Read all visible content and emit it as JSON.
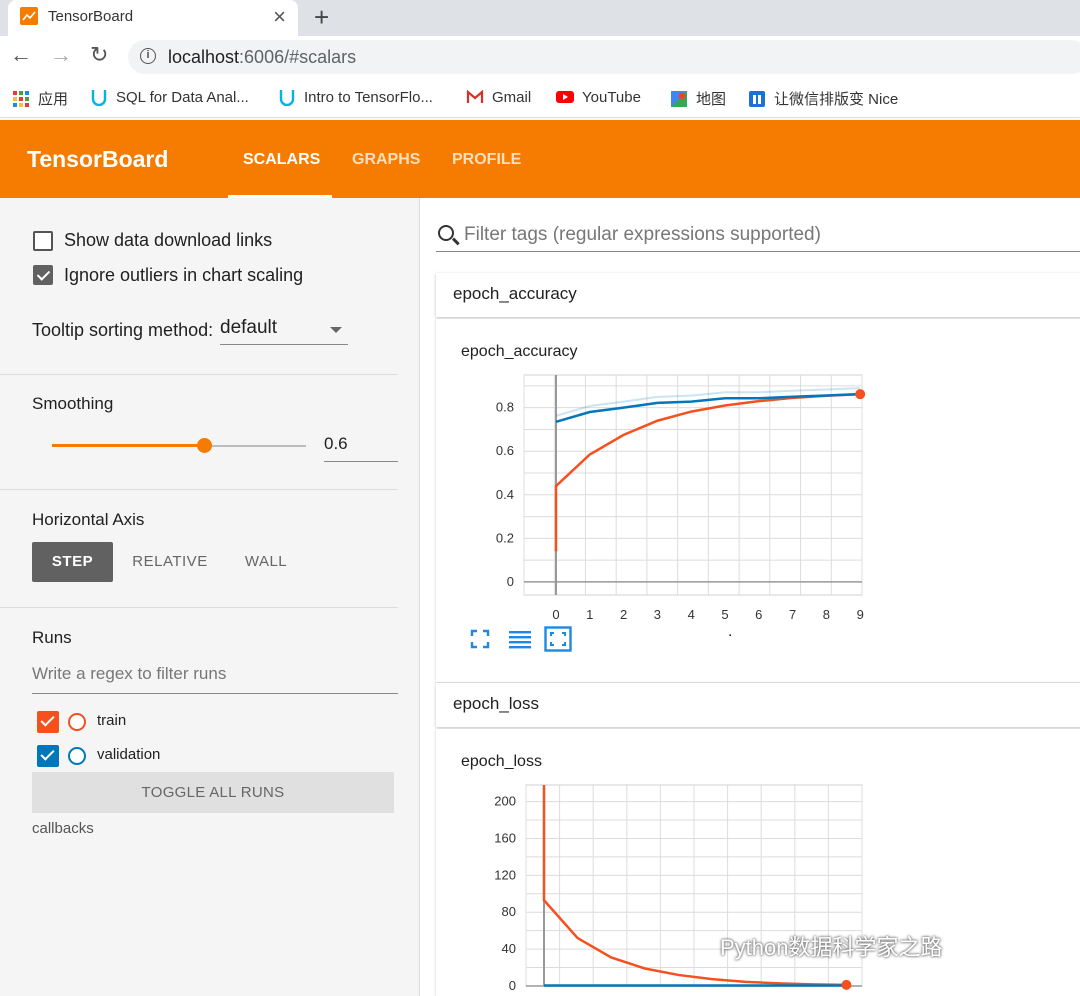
{
  "browser": {
    "tab_title": "TensorBoard",
    "url_host": "localhost",
    "url_rest": ":6006/#scalars",
    "bookmarks": [
      {
        "label": "应用",
        "icon": "apps-grid-icon"
      },
      {
        "label": "SQL for Data Anal...",
        "icon": "udacity-icon"
      },
      {
        "label": "Intro to TensorFlo...",
        "icon": "udacity-icon"
      },
      {
        "label": "Gmail",
        "icon": "gmail-icon"
      },
      {
        "label": "YouTube",
        "icon": "youtube-icon"
      },
      {
        "label": "地图",
        "icon": "maps-icon"
      },
      {
        "label": "让微信排版变 Nice",
        "icon": "nice-icon"
      }
    ]
  },
  "header": {
    "title": "TensorBoard",
    "tabs": [
      {
        "label": "SCALARS",
        "active": true
      },
      {
        "label": "GRAPHS",
        "active": false
      },
      {
        "label": "PROFILE",
        "active": false
      }
    ],
    "accent": "#f57c00"
  },
  "sidebar": {
    "show_download_links": "Show data download links",
    "ignore_outliers": "Ignore outliers in chart scaling",
    "tooltip_label": "Tooltip sorting method:",
    "tooltip_value": "default",
    "smoothing_label": "Smoothing",
    "smoothing_value": "0.6",
    "smoothing_level": 0.6,
    "horizontal_axis_label": "Horizontal Axis",
    "axis_buttons": [
      "STEP",
      "RELATIVE",
      "WALL"
    ],
    "runs_label": "Runs",
    "runs_filter_placeholder": "Write a regex to filter runs",
    "runs": [
      {
        "name": "train",
        "color": "#f4511e"
      },
      {
        "name": "validation",
        "color": "#0077bb"
      }
    ],
    "toggle_all": "TOGGLE ALL RUNS",
    "logdir": "callbacks"
  },
  "main": {
    "filter_placeholder": "Filter tags (regular expressions supported)",
    "cat_accuracy": "epoch_accuracy",
    "cat_loss": "epoch_loss",
    "dot": "."
  },
  "watermark": "Python数据科学家之路",
  "chart_data": [
    {
      "type": "line",
      "title": "epoch_accuracy",
      "x": [
        0,
        1,
        2,
        3,
        4,
        5,
        6,
        7,
        8,
        9
      ],
      "xticks": [
        "0",
        "1",
        "2",
        "3",
        "4",
        "5",
        "6",
        "7",
        "8",
        "9"
      ],
      "yticks": [
        "0",
        "0.2",
        "0.4",
        "0.6",
        "0.8"
      ],
      "ylim": [
        -0.06,
        0.95
      ],
      "series": [
        {
          "color": "#f4511e",
          "values": [
            0.44,
            0.585,
            0.675,
            0.74,
            0.782,
            0.81,
            0.83,
            0.845,
            0.855,
            0.862
          ],
          "raw_start": 0.14
        },
        {
          "color": "#0077bb",
          "values": [
            0.735,
            0.78,
            0.8,
            0.822,
            0.828,
            0.843,
            0.843,
            0.85,
            0.856,
            0.862
          ]
        }
      ],
      "grid": true
    },
    {
      "type": "line",
      "title": "epoch_loss",
      "x": [
        0,
        1,
        2,
        3,
        4,
        5,
        6,
        7,
        8,
        9
      ],
      "yticks": [
        "0",
        "40",
        "80",
        "120",
        "160",
        "200"
      ],
      "ylim": [
        0,
        218
      ],
      "series": [
        {
          "color": "#f4511e",
          "values": [
            93,
            52,
            31,
            19,
            12,
            7.5,
            4.5,
            2.8,
            1.8,
            1.2
          ],
          "raw_start": 230
        },
        {
          "color": "#0077bb",
          "values": [
            0.6,
            0.5,
            0.5,
            0.5,
            0.5,
            0.5,
            0.5,
            0.5,
            0.5,
            0.5
          ]
        }
      ],
      "grid": true
    }
  ]
}
